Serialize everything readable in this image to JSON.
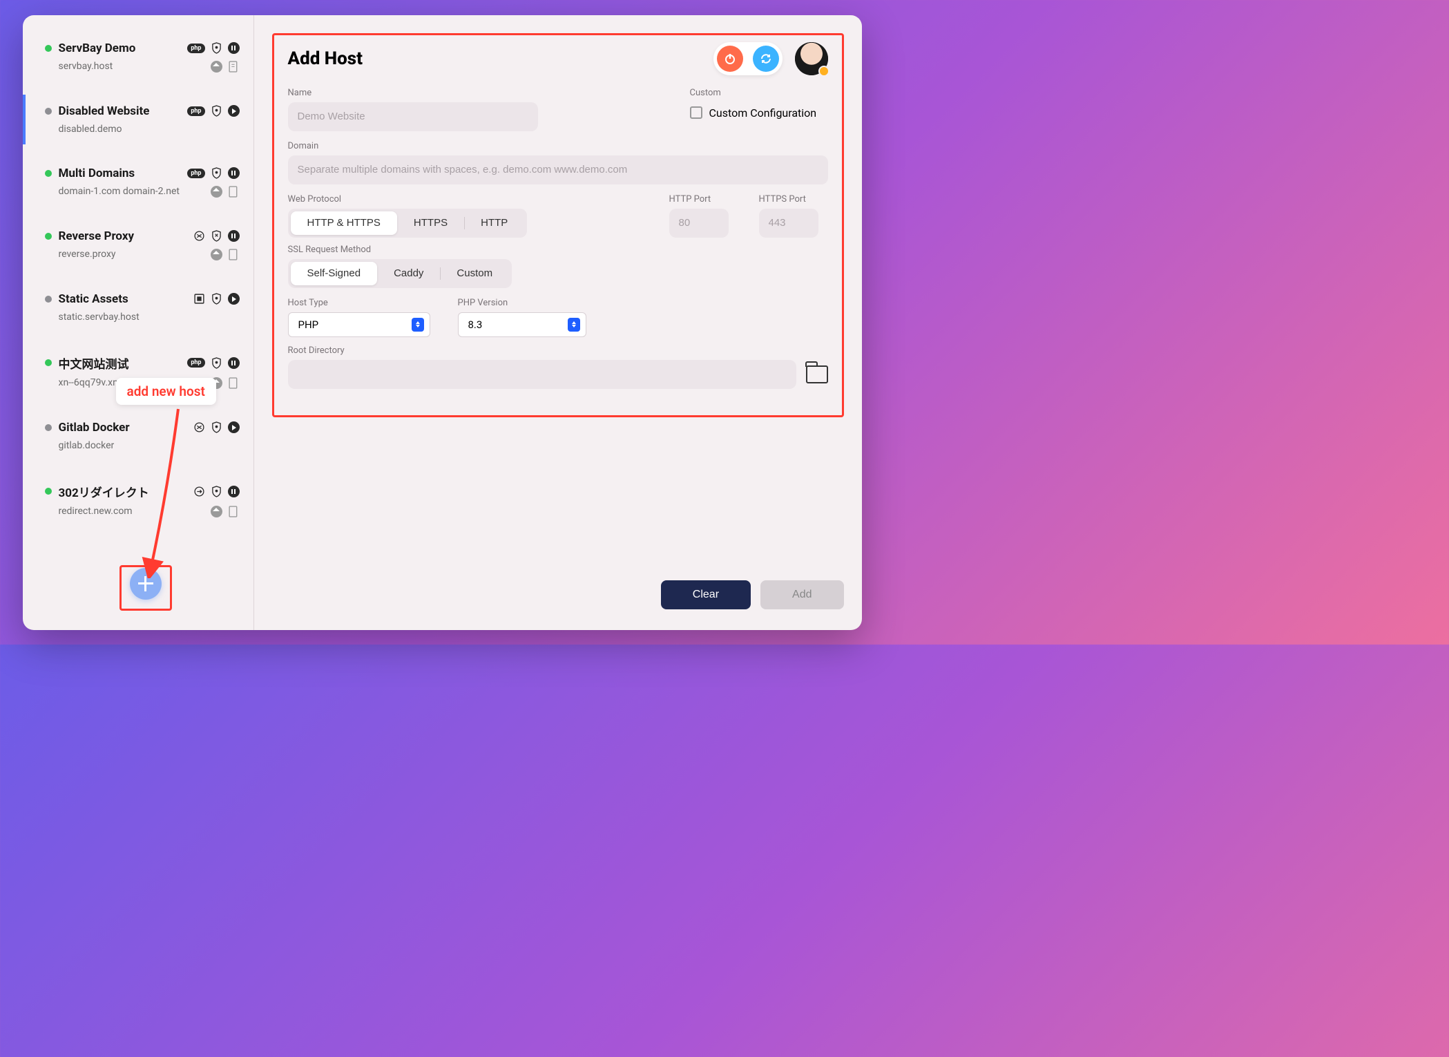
{
  "sidebar": {
    "items": [
      {
        "title": "ServBay Demo",
        "domain": "servbay.host",
        "status": "g",
        "type": "php",
        "action": "pause"
      },
      {
        "title": "Disabled Website",
        "domain": "disabled.demo",
        "status": "gr",
        "type": "php",
        "action": "play"
      },
      {
        "title": "Multi Domains",
        "domain": "domain-1.com domain-2.net",
        "status": "g",
        "type": "php",
        "action": "pause"
      },
      {
        "title": "Reverse Proxy",
        "domain": "reverse.proxy",
        "status": "g",
        "type": "proxy",
        "action": "pause"
      },
      {
        "title": "Static Assets",
        "domain": "static.servbay.host",
        "status": "gr",
        "type": "static",
        "action": "play"
      },
      {
        "title": "中文网站测试",
        "domain": "xn--6qq79v.xn--fiqs8s",
        "status": "g",
        "type": "php",
        "action": "pause"
      },
      {
        "title": "Gitlab Docker",
        "domain": "gitlab.docker",
        "status": "gr",
        "type": "proxy",
        "action": "play"
      },
      {
        "title": "302リダイレクト",
        "domain": "redirect.new.com",
        "status": "g",
        "type": "redirect",
        "action": "pause"
      }
    ]
  },
  "annotation": {
    "callout": "add new host"
  },
  "main": {
    "title": "Add Host",
    "name_label": "Name",
    "name_placeholder": "Demo Website",
    "custom_label": "Custom",
    "custom_check": "Custom Configuration",
    "domain_label": "Domain",
    "domain_placeholder": "Separate multiple domains with spaces, e.g. demo.com www.demo.com",
    "protocol_label": "Web Protocol",
    "protocol_options": [
      "HTTP & HTTPS",
      "HTTPS",
      "HTTP"
    ],
    "protocol_selected": "HTTP & HTTPS",
    "http_port_label": "HTTP Port",
    "http_port_placeholder": "80",
    "https_port_label": "HTTPS Port",
    "https_port_placeholder": "443",
    "ssl_label": "SSL Request Method",
    "ssl_options": [
      "Self-Signed",
      "Caddy",
      "Custom"
    ],
    "ssl_selected": "Self-Signed",
    "hosttype_label": "Host Type",
    "hosttype_value": "PHP",
    "phpver_label": "PHP Version",
    "phpver_value": "8.3",
    "root_label": "Root Directory"
  },
  "footer": {
    "clear": "Clear",
    "add": "Add"
  }
}
